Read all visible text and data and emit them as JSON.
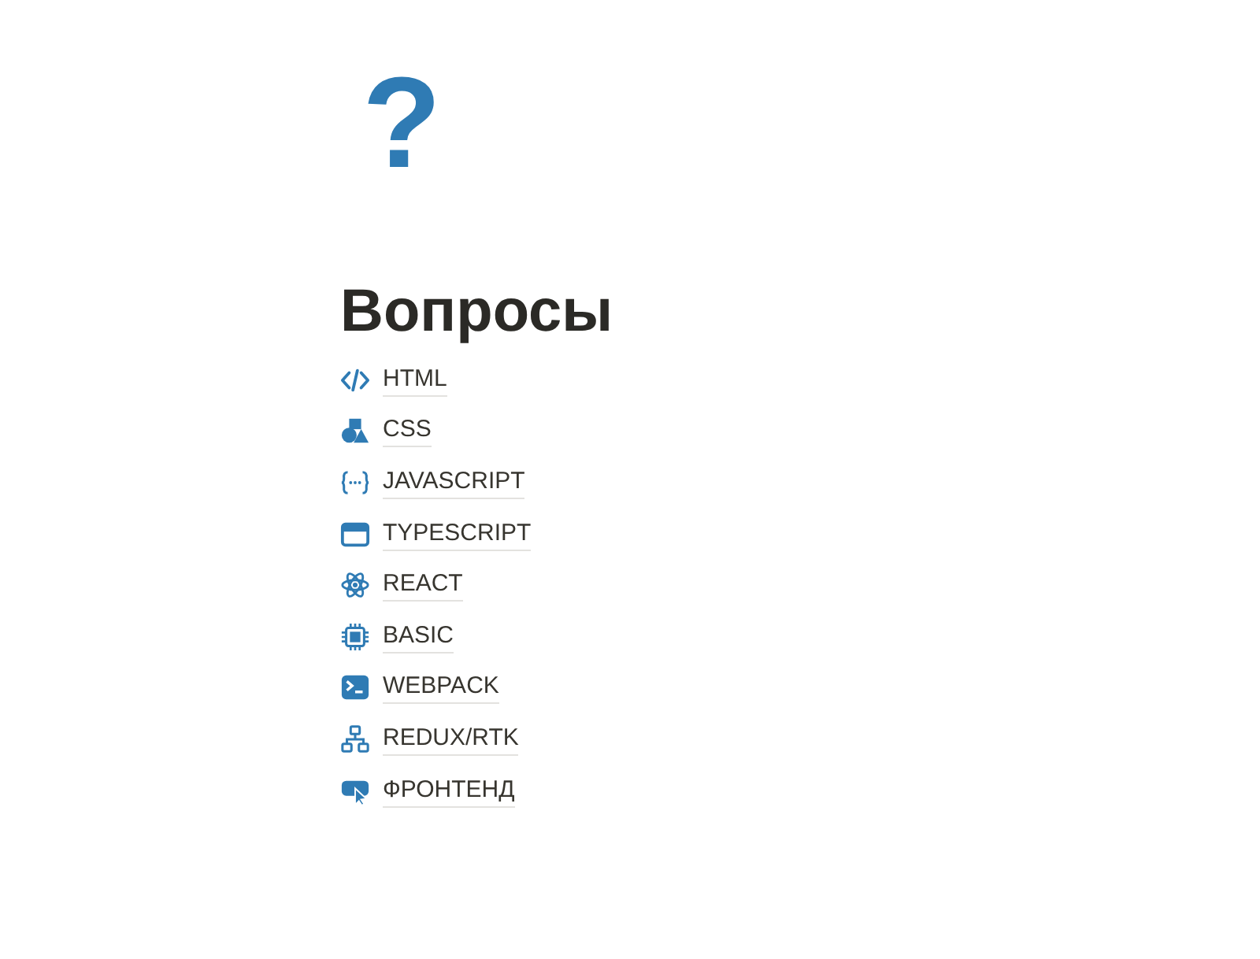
{
  "page_icon": "?",
  "title": "Вопросы",
  "links": [
    {
      "label": "HTML"
    },
    {
      "label": "CSS"
    },
    {
      "label": "JAVASCRIPT"
    },
    {
      "label": "TYPESCRIPT"
    },
    {
      "label": "REACT"
    },
    {
      "label": "BASIC"
    },
    {
      "label": "WEBPACK"
    },
    {
      "label": "REDUX/RTK"
    },
    {
      "label": "ФРОНТЕНД"
    }
  ]
}
